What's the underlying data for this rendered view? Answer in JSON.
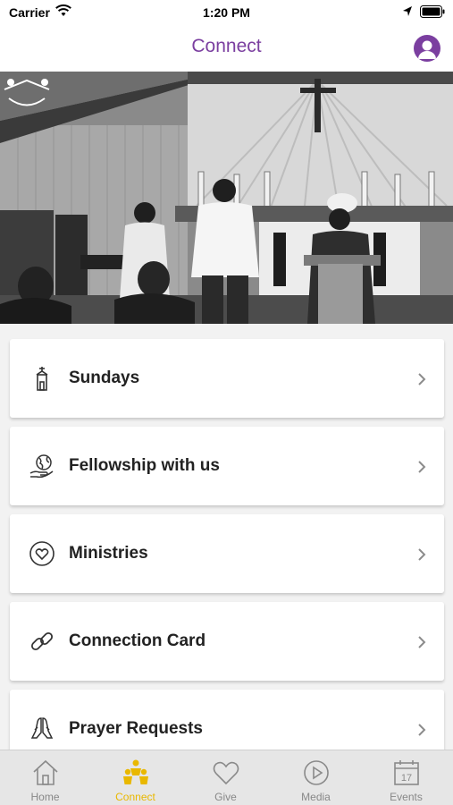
{
  "status_bar": {
    "carrier": "Carrier",
    "time": "1:20 PM"
  },
  "nav": {
    "title": "Connect"
  },
  "colors": {
    "accent": "#7b3fa0",
    "tab_active": "#e9b800",
    "tab_inactive": "#888888"
  },
  "menu": [
    {
      "label": "Sundays",
      "icon": "church-icon"
    },
    {
      "label": "Fellowship with us",
      "icon": "globe-hand-icon"
    },
    {
      "label": "Ministries",
      "icon": "heart-circle-icon"
    },
    {
      "label": "Connection Card",
      "icon": "link-icon"
    },
    {
      "label": "Prayer Requests",
      "icon": "praying-hands-icon"
    }
  ],
  "tabs": [
    {
      "label": "Home",
      "icon": "home-icon",
      "active": false
    },
    {
      "label": "Connect",
      "icon": "people-icon",
      "active": true
    },
    {
      "label": "Give",
      "icon": "heart-icon",
      "active": false
    },
    {
      "label": "Media",
      "icon": "play-icon",
      "active": false
    },
    {
      "label": "Events",
      "icon": "calendar-icon",
      "active": false,
      "badge": "17"
    }
  ]
}
